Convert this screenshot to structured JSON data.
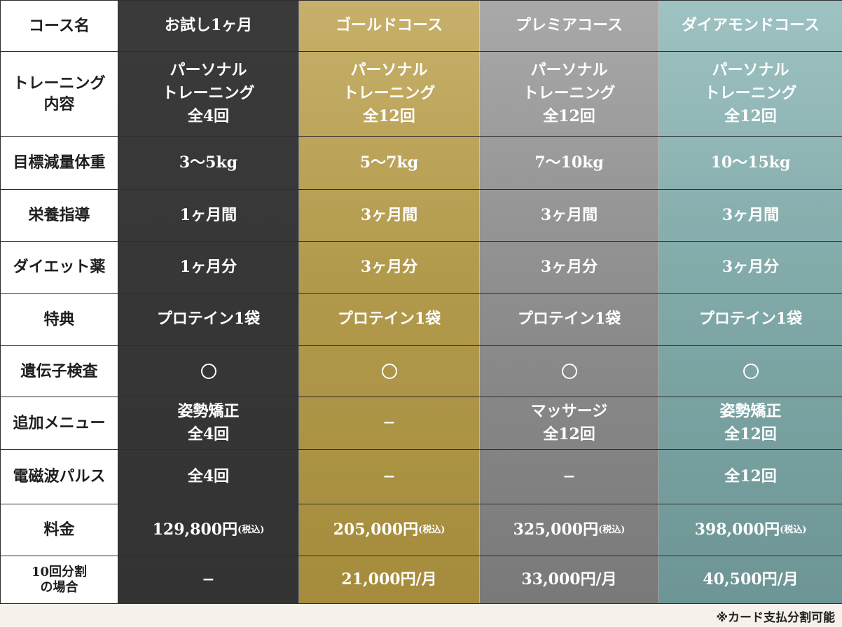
{
  "rows": [
    {
      "label": "コース名",
      "trial": "お試し1ヶ月",
      "gold": "ゴールドコース",
      "premium": "プレミアコース",
      "diamond": "ダイアモンドコース"
    },
    {
      "label": "トレーニング\n内容",
      "trial": "パーソナル\nトレーニング\n全4回",
      "gold": "パーソナル\nトレーニング\n全12回",
      "premium": "パーソナル\nトレーニング\n全12回",
      "diamond": "パーソナル\nトレーニング\n全12回"
    },
    {
      "label": "目標減量体重",
      "trial": "3～5kg",
      "gold": "5～7kg",
      "premium": "7～10kg",
      "diamond": "10～15kg"
    },
    {
      "label": "栄養指導",
      "trial": "1ヶ月間",
      "gold": "3ヶ月間",
      "premium": "3ヶ月間",
      "diamond": "3ヶ月間"
    },
    {
      "label": "ダイエット薬",
      "trial": "1ヶ月分",
      "gold": "3ヶ月分",
      "premium": "3ヶ月分",
      "diamond": "3ヶ月分"
    },
    {
      "label": "特典",
      "trial": "プロテイン1袋",
      "gold": "プロテイン1袋",
      "premium": "プロテイン1袋",
      "diamond": "プロテイン1袋"
    },
    {
      "label": "遺伝子検査",
      "trial": "circle",
      "gold": "circle",
      "premium": "circle",
      "diamond": "circle"
    },
    {
      "label": "追加メニュー",
      "trial": "姿勢矯正\n全4回",
      "gold": "−",
      "premium": "マッサージ\n全12回",
      "diamond": "姿勢矯正\n全12回"
    },
    {
      "label": "電磁波パルス",
      "trial": "全4回",
      "gold": "−",
      "premium": "−",
      "diamond": "全12回"
    },
    {
      "label": "料金",
      "trial": "129,800円",
      "gold": "205,000円",
      "premium": "325,000円",
      "diamond": "398,000円",
      "tax": "(税込)"
    },
    {
      "label": "10回分割\nの場合",
      "trial": "−",
      "gold": "21,000円/月",
      "premium": "33,000円/月",
      "diamond": "40,500円/月"
    }
  ],
  "footnote": "※カード支払分割可能"
}
